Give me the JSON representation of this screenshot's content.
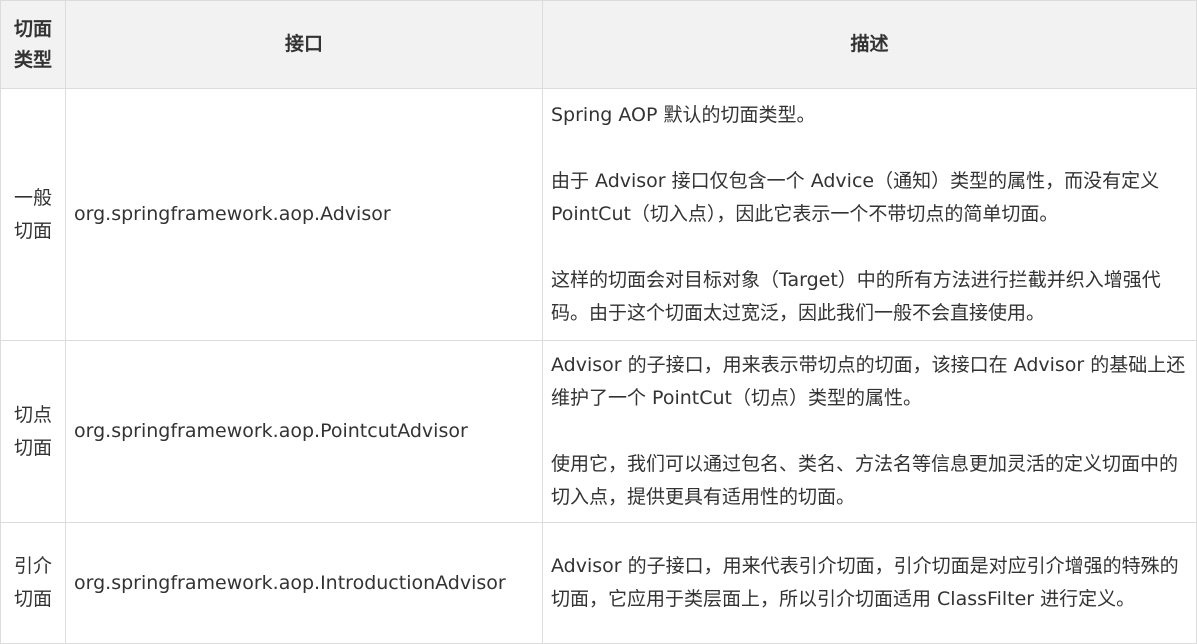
{
  "table": {
    "headers": {
      "type": "切面类型",
      "interface": "接口",
      "description": "描述"
    },
    "rows": [
      {
        "type": "一般切面",
        "interface": "org.springframework.aop.Advisor",
        "description": [
          "Spring AOP 默认的切面类型。",
          "由于 Advisor 接口仅包含一个 Advice（通知）类型的属性，而没有定义 PointCut（切入点），因此它表示一个不带切点的简单切面。",
          "这样的切面会对目标对象（Target）中的所有方法进行拦截并织入增强代码。由于这个切面太过宽泛，因此我们一般不会直接使用。"
        ]
      },
      {
        "type": "切点切面",
        "interface": "org.springframework.aop.PointcutAdvisor",
        "description": [
          "Advisor 的子接口，用来表示带切点的切面，该接口在 Advisor 的基础上还维护了一个 PointCut（切点）类型的属性。",
          "使用它，我们可以通过包名、类名、方法名等信息更加灵活的定义切面中的切入点，提供更具有适用性的切面。"
        ]
      },
      {
        "type": "引介切面",
        "interface": "org.springframework.aop.IntroductionAdvisor",
        "description": [
          "Advisor 的子接口，用来代表引介切面，引介切面是对应引介增强的特殊的切面，它应用于类层面上，所以引介切面适用 ClassFilter 进行定义。"
        ]
      }
    ]
  }
}
